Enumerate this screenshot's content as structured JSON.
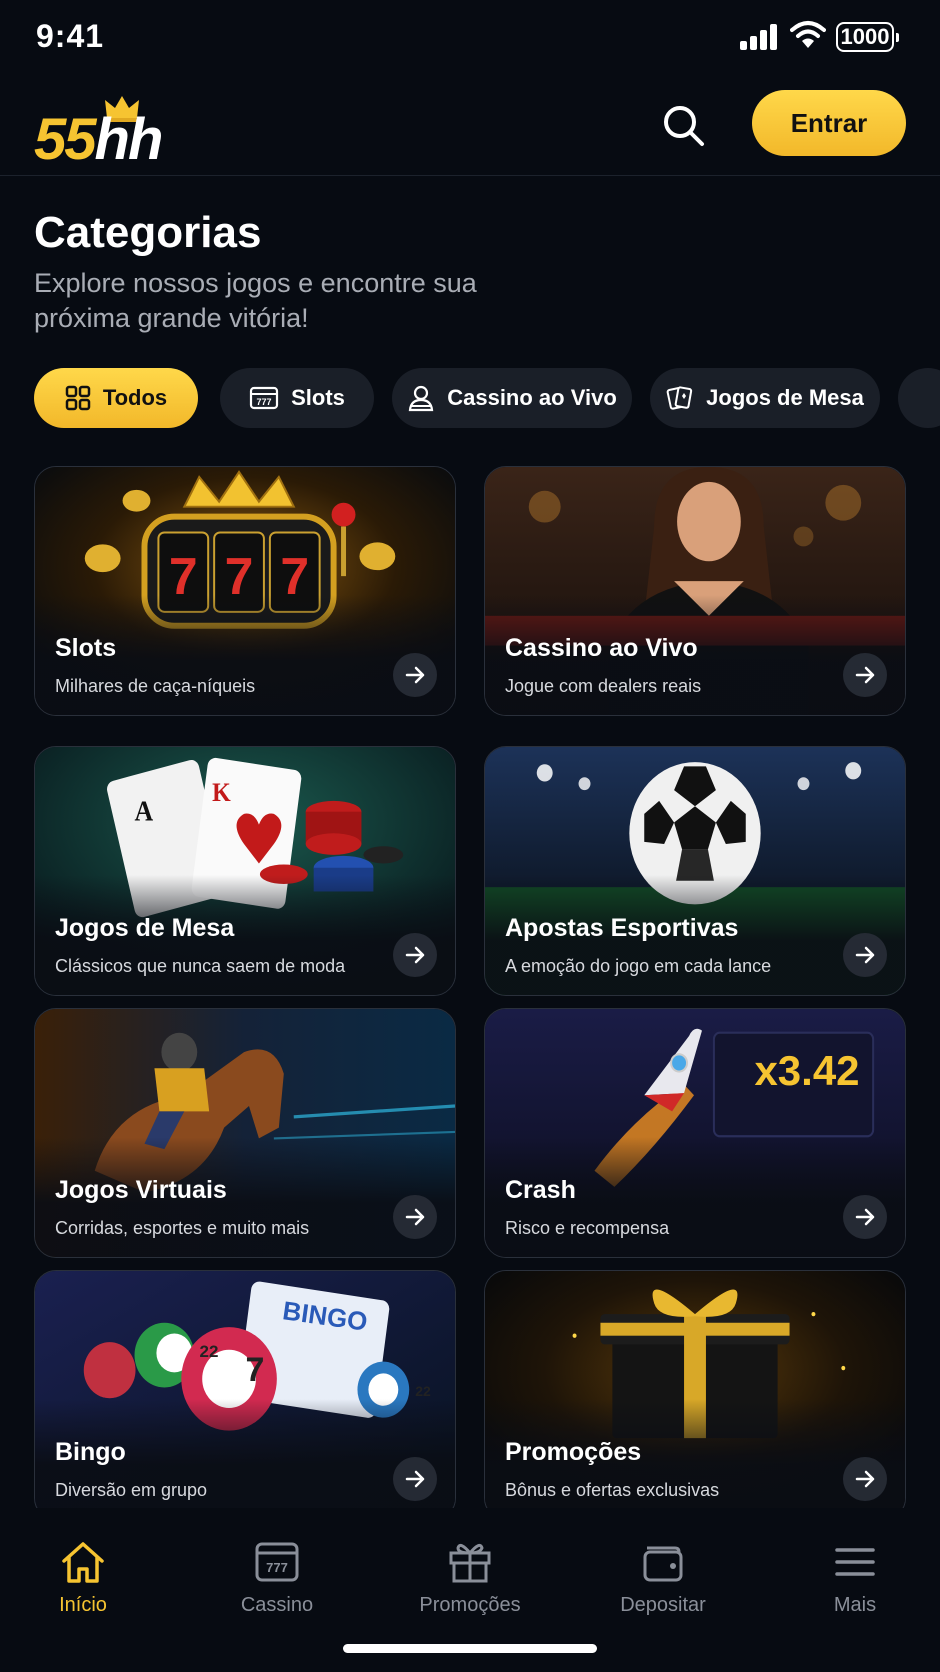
{
  "status": {
    "time": "9:41",
    "battery": "1000"
  },
  "header": {
    "logo_part1": "55",
    "logo_part2": "hh",
    "login_label": "Entrar"
  },
  "page": {
    "title": "Categorias",
    "subtitle": "Explore nossos jogos e encontre sua próxima grande vitória!"
  },
  "chips": [
    {
      "label": "Todos",
      "icon": "grid-icon",
      "active": true
    },
    {
      "label": "Slots",
      "icon": "slot-machine-icon",
      "active": false
    },
    {
      "label": "Cassino ao Vivo",
      "icon": "dealer-icon",
      "active": false
    },
    {
      "label": "Jogos de Mesa",
      "icon": "cards-icon",
      "active": false
    }
  ],
  "cards": [
    {
      "title": "Slots",
      "desc": "Milhares de caça-níqueis",
      "art": "slot-machine-777-art"
    },
    {
      "title": "Cassino ao Vivo",
      "desc": "Jogue com dealers reais",
      "art": "live-dealer-art"
    },
    {
      "title": "Jogos de Mesa",
      "desc": "Clássicos que nunca saem de moda",
      "art": "cards-chips-art"
    },
    {
      "title": "Apostas Esportivas",
      "desc": "A emoção do jogo em cada lance",
      "art": "soccer-ball-art"
    },
    {
      "title": "Jogos Virtuais",
      "desc": "Corridas, esportes e muito mais",
      "art": "horse-race-art"
    },
    {
      "title": "Crash",
      "desc": "Risco e recompensa",
      "art": "rocket-art",
      "multiplier": "x3.42"
    },
    {
      "title": "Bingo",
      "desc": "Diversão em grupo",
      "art": "bingo-balls-art",
      "bingo_word": "BINGO",
      "ball_numbers": [
        "22",
        "7",
        "22"
      ]
    },
    {
      "title": "Promoções",
      "desc": "Bônus e ofertas exclusivas",
      "art": "gift-box-art"
    }
  ],
  "tabbar": [
    {
      "label": "Início",
      "icon": "home-icon",
      "active": true
    },
    {
      "label": "Cassino",
      "icon": "slot-machine-icon",
      "active": false
    },
    {
      "label": "Promoções",
      "icon": "gift-icon",
      "active": false
    },
    {
      "label": "Depositar",
      "icon": "wallet-icon",
      "active": false
    },
    {
      "label": "Mais",
      "icon": "menu-icon",
      "active": false
    }
  ],
  "colors": {
    "accent": "#f6c431",
    "background": "#070b12",
    "chip_bg": "#1a1f28",
    "muted": "#8a8f99"
  }
}
